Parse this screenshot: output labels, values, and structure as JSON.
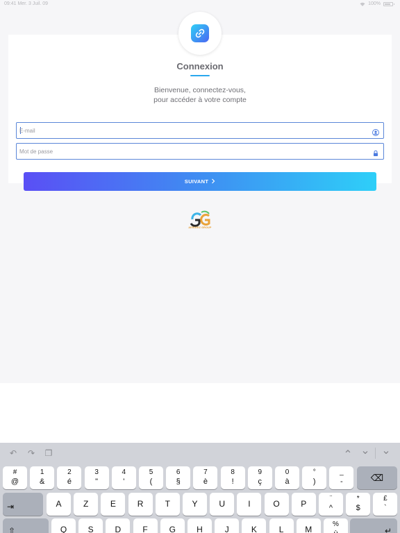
{
  "status_bar": {
    "left": "09:41 Mer. 3 Juil. 09",
    "right": "100%"
  },
  "login": {
    "title": "Connexion",
    "welcome_line1": "Bienvenue, connectez-vous,",
    "welcome_line2": "pour accéder à votre compte",
    "email_placeholder": "E-mail",
    "password_placeholder": "Mot de passe",
    "next_label": "SUIVANT",
    "brand_text": "AERIGEZ GROUP"
  },
  "icons": {
    "app_logo": "link-icon",
    "email_field": "user-icon",
    "password_field": "lock-icon",
    "next_button": "chevron-right-icon"
  },
  "colors": {
    "accent": "#2aa8ee",
    "button_gradient_start": "#5a4ff5",
    "button_gradient_end": "#2ecff8",
    "field_border": "#5a86d8"
  },
  "keyboard": {
    "toolbar": {
      "undo": "↶",
      "redo": "↷",
      "paste": "❐",
      "up": "⌃",
      "down": "⌄",
      "dismiss": "⌄"
    },
    "row1": [
      {
        "top": "#",
        "bot": "@"
      },
      {
        "top": "1",
        "bot": "&"
      },
      {
        "top": "2",
        "bot": "é"
      },
      {
        "top": "3",
        "bot": "\""
      },
      {
        "top": "4",
        "bot": "'"
      },
      {
        "top": "5",
        "bot": "("
      },
      {
        "top": "6",
        "bot": "§"
      },
      {
        "top": "7",
        "bot": "è"
      },
      {
        "top": "8",
        "bot": "!"
      },
      {
        "top": "9",
        "bot": "ç"
      },
      {
        "top": "0",
        "bot": "à"
      },
      {
        "top": "°",
        "bot": ")"
      },
      {
        "top": "_",
        "bot": "-"
      }
    ],
    "row2": [
      "A",
      "Z",
      "E",
      "R",
      "T",
      "Y",
      "U",
      "I",
      "O",
      "P"
    ],
    "row2_extra": [
      {
        "top": "¨",
        "bot": "^"
      },
      {
        "top": "*",
        "bot": "$"
      },
      {
        "top": "£",
        "bot": "`"
      }
    ],
    "row3": [
      "Q",
      "S",
      "D",
      "F",
      "G",
      "H",
      "J",
      "K",
      "L",
      "M"
    ],
    "row3_extra": [
      {
        "top": "%",
        "bot": "ù"
      }
    ],
    "delete": "⌫",
    "tab": "⇥",
    "shift": "⇧",
    "return": "↵"
  }
}
